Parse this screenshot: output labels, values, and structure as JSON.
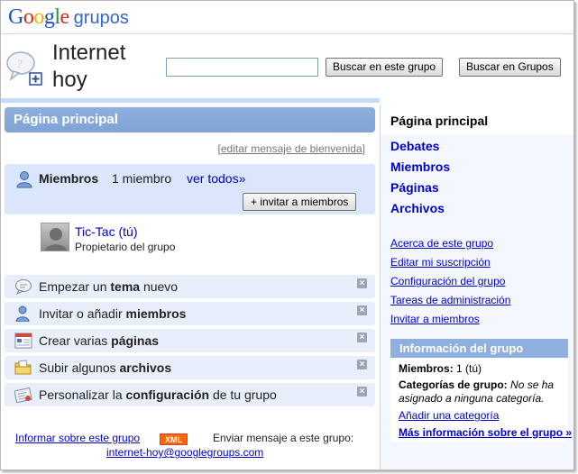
{
  "header": {
    "logo_google": "Google",
    "logo_product": "grupos",
    "group_name": "Internet hoy",
    "search_placeholder": "",
    "search_group_button": "Buscar en este grupo",
    "search_all_button": "Buscar en Grupos"
  },
  "main": {
    "title": "Página principal",
    "edit_welcome": "editar mensaje de bienvenida",
    "members": {
      "label": "Miembros",
      "count": "1 miembro",
      "see_all": "ver todos»",
      "invite_button": "+ invitar a miembros"
    },
    "owner": {
      "name": "Tic-Tac (tú)",
      "role": "Propietario del grupo"
    },
    "tasks": [
      {
        "pre": "Empezar un ",
        "bold": "tema",
        "post": " nuevo",
        "icon": "speech-bubble-icon"
      },
      {
        "pre": "Invitar o añadir ",
        "bold": "miembros",
        "post": "",
        "icon": "person-icon"
      },
      {
        "pre": "Crear varias ",
        "bold": "páginas",
        "post": "",
        "icon": "pages-icon"
      },
      {
        "pre": "Subir algunos ",
        "bold": "archivos",
        "post": "",
        "icon": "folder-icon"
      },
      {
        "pre": "Personalizar la ",
        "bold": "configuración",
        "post": " de tu grupo",
        "icon": "settings-icon"
      }
    ],
    "footer": {
      "report": "Informar sobre este grupo",
      "xml": "XML",
      "send_label": "Enviar mensaje a este grupo:",
      "email": "internet-hoy@googlegroups.com"
    }
  },
  "sidebar": {
    "current": "Página principal",
    "main_links": [
      "Debates",
      "Miembros",
      "Páginas",
      "Archivos"
    ],
    "sub_links": [
      "Acerca de este grupo",
      "Editar mi suscripción",
      "Configuración del grupo",
      "Tareas de administración",
      "Invitar a miembros"
    ],
    "info": {
      "title": "Información del grupo",
      "members_label": "Miembros:",
      "members_value": "1 (tú)",
      "categories_label": "Categorías de grupo:",
      "categories_value": "No se ha asignado a ninguna categoría.",
      "add_category": "Añadir una categoría",
      "more_info": "Más información sobre el grupo »"
    }
  },
  "colors": {
    "accent": "#8fb0de",
    "link": "#0000cc",
    "light_panel": "#dae6fb",
    "task_bg": "#e8eefa"
  }
}
